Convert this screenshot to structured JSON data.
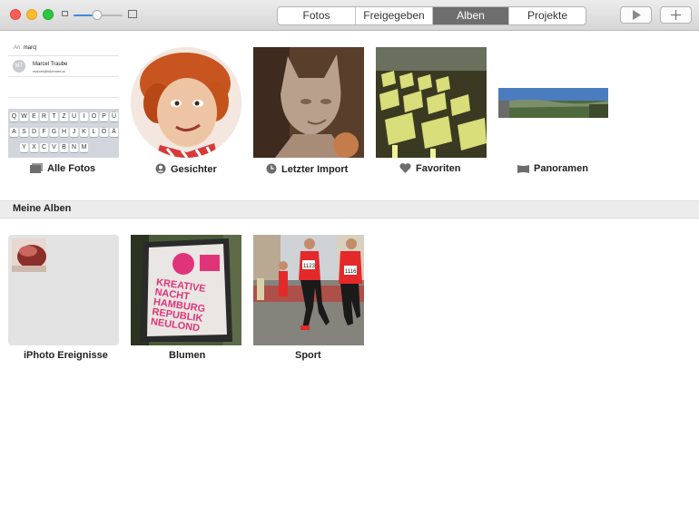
{
  "toolbar": {
    "tabs": [
      {
        "label": "Fotos",
        "active": false
      },
      {
        "label": "Freigegeben",
        "active": false
      },
      {
        "label": "Alben",
        "active": true
      },
      {
        "label": "Projekte",
        "active": false
      }
    ],
    "zoom_level_fraction": 0.48,
    "play_icon": "play-icon",
    "add_icon": "plus-icon"
  },
  "top_albums": [
    {
      "label": "Alle Fotos",
      "icon": "photos-stack-icon"
    },
    {
      "label": "Gesichter",
      "icon": "face-icon"
    },
    {
      "label": "Letzter Import",
      "icon": "clock-icon"
    },
    {
      "label": "Favoriten",
      "icon": "heart-icon"
    },
    {
      "label": "Panoramen",
      "icon": "panorama-icon"
    }
  ],
  "mail_thumb": {
    "to_label": "An:",
    "to_value": "marc|",
    "initials": "MT",
    "contact_name": "Marcel Traube",
    "contact_email": "marcel@fokemed.ia",
    "keyboard_rows": [
      [
        "Q",
        "W",
        "E",
        "R",
        "T",
        "Z",
        "U",
        "I",
        "O",
        "P",
        "Ü"
      ],
      [
        "A",
        "S",
        "D",
        "F",
        "G",
        "H",
        "J",
        "K",
        "L",
        "Ö",
        "Ä"
      ],
      [
        "Y",
        "X",
        "C",
        "V",
        "B",
        "N",
        "M"
      ]
    ]
  },
  "section": {
    "title": "Meine Alben"
  },
  "my_albums": [
    {
      "label": "iPhoto Ereignisse"
    },
    {
      "label": "Blumen"
    },
    {
      "label": "Sport"
    }
  ],
  "poster_text": "KREATIVE NACHT HAMBURG REPUBLIK NEULOND",
  "bib_numbers": [
    "1123",
    "1116"
  ],
  "colors": {
    "accent": "#3b88e6",
    "active_tab": "#6e6e6e",
    "section_bar": "#ececec",
    "close": "#fc5f57",
    "minimize": "#fdbc2e",
    "maximize": "#29c840"
  }
}
